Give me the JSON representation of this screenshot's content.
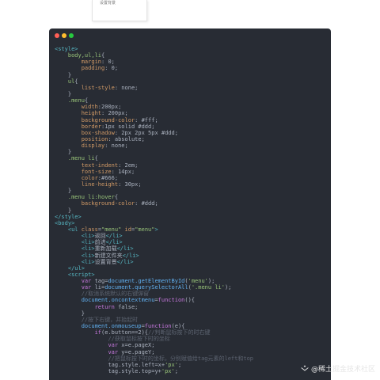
{
  "menu_preview": {
    "item": "设置背景"
  },
  "window": {
    "controls": [
      "close",
      "minimize",
      "maximize"
    ]
  },
  "code_lines": [
    [
      [
        "tag",
        "<style>"
      ]
    ],
    [
      [
        "txt",
        "    "
      ],
      [
        "sel",
        "body,ul,li"
      ],
      [
        "punc",
        "{"
      ]
    ],
    [
      [
        "txt",
        "        "
      ],
      [
        "prop",
        "margin"
      ],
      [
        "punc",
        ": 0;"
      ]
    ],
    [
      [
        "txt",
        "        "
      ],
      [
        "prop",
        "padding"
      ],
      [
        "punc",
        ": 0;"
      ]
    ],
    [
      [
        "txt",
        "    "
      ],
      [
        "punc",
        "}"
      ]
    ],
    [
      [
        "txt",
        "    "
      ],
      [
        "sel",
        "ul"
      ],
      [
        "punc",
        "{"
      ]
    ],
    [
      [
        "txt",
        "        "
      ],
      [
        "prop",
        "list-style"
      ],
      [
        "punc",
        ": none;"
      ]
    ],
    [
      [
        "txt",
        "    "
      ],
      [
        "punc",
        "}"
      ]
    ],
    [
      [
        "txt",
        "    "
      ],
      [
        "sel",
        ".menu"
      ],
      [
        "punc",
        "{"
      ]
    ],
    [
      [
        "txt",
        "        "
      ],
      [
        "prop",
        "width"
      ],
      [
        "punc",
        ":200px;"
      ]
    ],
    [
      [
        "txt",
        "        "
      ],
      [
        "prop",
        "height"
      ],
      [
        "punc",
        ": 200px;"
      ]
    ],
    [
      [
        "txt",
        "        "
      ],
      [
        "prop",
        "background-color"
      ],
      [
        "punc",
        ": #fff;"
      ]
    ],
    [
      [
        "txt",
        "        "
      ],
      [
        "prop",
        "border"
      ],
      [
        "punc",
        ":1px solid #ddd;"
      ]
    ],
    [
      [
        "txt",
        "        "
      ],
      [
        "prop",
        "box-shadow"
      ],
      [
        "punc",
        ": 2px 2px 5px #ddd;"
      ]
    ],
    [
      [
        "txt",
        "        "
      ],
      [
        "prop",
        "position"
      ],
      [
        "punc",
        ": absolute;"
      ]
    ],
    [
      [
        "txt",
        "        "
      ],
      [
        "prop",
        "display"
      ],
      [
        "punc",
        ": none;"
      ]
    ],
    [
      [
        "txt",
        "    "
      ],
      [
        "punc",
        "}"
      ]
    ],
    [
      [
        "txt",
        "    "
      ],
      [
        "sel",
        ".menu li"
      ],
      [
        "punc",
        "{"
      ]
    ],
    [
      [
        "txt",
        "        "
      ],
      [
        "prop",
        "text-indent"
      ],
      [
        "punc",
        ": 2em;"
      ]
    ],
    [
      [
        "txt",
        "        "
      ],
      [
        "prop",
        "font-size"
      ],
      [
        "punc",
        ": 14px;"
      ]
    ],
    [
      [
        "txt",
        "        "
      ],
      [
        "prop",
        "color"
      ],
      [
        "punc",
        ":#666;"
      ]
    ],
    [
      [
        "txt",
        "        "
      ],
      [
        "prop",
        "line-height"
      ],
      [
        "punc",
        ": 30px;"
      ]
    ],
    [
      [
        "txt",
        "    "
      ],
      [
        "punc",
        "}"
      ]
    ],
    [
      [
        "txt",
        "    "
      ],
      [
        "sel",
        ".menu li:hover"
      ],
      [
        "punc",
        "{"
      ]
    ],
    [
      [
        "txt",
        "        "
      ],
      [
        "prop",
        "background-color"
      ],
      [
        "punc",
        ": #ddd;"
      ]
    ],
    [
      [
        "txt",
        "    "
      ],
      [
        "punc",
        "}"
      ]
    ],
    [
      [
        "tag",
        "</style>"
      ]
    ],
    [
      [
        "tag",
        "<body>"
      ]
    ],
    [
      [
        "txt",
        "    "
      ],
      [
        "tag",
        "<ul"
      ],
      [
        "prop",
        " class"
      ],
      [
        "punc",
        "="
      ],
      [
        "str",
        "\"menu\""
      ],
      [
        "prop",
        " id"
      ],
      [
        "punc",
        "="
      ],
      [
        "str",
        "\"menu\""
      ],
      [
        "tag",
        ">"
      ]
    ],
    [
      [
        "txt",
        "        "
      ],
      [
        "tag",
        "<li>"
      ],
      [
        "txt",
        "返回"
      ],
      [
        "tag",
        "</li>"
      ]
    ],
    [
      [
        "txt",
        "        "
      ],
      [
        "tag",
        "<li>"
      ],
      [
        "txt",
        "前进"
      ],
      [
        "tag",
        "</li>"
      ]
    ],
    [
      [
        "txt",
        "        "
      ],
      [
        "tag",
        "<li>"
      ],
      [
        "txt",
        "重新加载"
      ],
      [
        "tag",
        "</li>"
      ]
    ],
    [
      [
        "txt",
        "        "
      ],
      [
        "tag",
        "<li>"
      ],
      [
        "txt",
        "新建文件夹"
      ],
      [
        "tag",
        "</li>"
      ]
    ],
    [
      [
        "txt",
        "        "
      ],
      [
        "tag",
        "<li>"
      ],
      [
        "txt",
        "设置背景"
      ],
      [
        "tag",
        "</li>"
      ]
    ],
    [
      [
        "txt",
        "    "
      ],
      [
        "tag",
        "</ul>"
      ]
    ],
    [
      [
        "txt",
        "    "
      ],
      [
        "tag",
        "<script>"
      ]
    ],
    [
      [
        "txt",
        "        "
      ],
      [
        "kw",
        "var"
      ],
      [
        "txt",
        " tag="
      ],
      [
        "fn",
        "document.getElementById"
      ],
      [
        "punc",
        "("
      ],
      [
        "str",
        "'menu'"
      ],
      [
        "punc",
        ");"
      ]
    ],
    [
      [
        "txt",
        "        "
      ],
      [
        "kw",
        "var"
      ],
      [
        "txt",
        " li="
      ],
      [
        "fn",
        "document.querySelectorAll"
      ],
      [
        "punc",
        "("
      ],
      [
        "str",
        "'.menu li'"
      ],
      [
        "punc",
        ");"
      ]
    ],
    [
      [
        "txt",
        "        "
      ],
      [
        "cmt",
        "//取消系统默认的右键弹窗"
      ]
    ],
    [
      [
        "txt",
        "        "
      ],
      [
        "fn",
        "document.oncontextmenu"
      ],
      [
        "punc",
        "="
      ],
      [
        "kw",
        "function"
      ],
      [
        "punc",
        "(){"
      ]
    ],
    [
      [
        "txt",
        "            "
      ],
      [
        "kw",
        "return"
      ],
      [
        "txt",
        " false;"
      ]
    ],
    [
      [
        "txt",
        "        "
      ],
      [
        "punc",
        "}"
      ]
    ],
    [
      [
        "txt",
        "        "
      ],
      [
        "cmt",
        "//按下右键，并抬起时"
      ]
    ],
    [
      [
        "txt",
        "        "
      ],
      [
        "fn",
        "document.onmouseup"
      ],
      [
        "punc",
        "="
      ],
      [
        "kw",
        "function"
      ],
      [
        "punc",
        "(e){"
      ]
    ],
    [
      [
        "txt",
        "            "
      ],
      [
        "kw",
        "if"
      ],
      [
        "punc",
        "("
      ],
      [
        "txt",
        "e.button==2"
      ],
      [
        "punc",
        "){"
      ],
      [
        "cmt",
        "//判断鼠标按下的时右键"
      ]
    ],
    [
      [
        "txt",
        "                "
      ],
      [
        "cmt",
        "//获取鼠标按下时的坐标"
      ]
    ],
    [
      [
        "txt",
        "                "
      ],
      [
        "kw",
        "var"
      ],
      [
        "txt",
        " x=e.pageX;"
      ]
    ],
    [
      [
        "txt",
        "                "
      ],
      [
        "kw",
        "var"
      ],
      [
        "txt",
        " y=e.pageY;"
      ]
    ],
    [
      [
        "txt",
        "                "
      ],
      [
        "cmt",
        "//把鼠标按下时的坐标，分别赋值给tag元素的left和top"
      ]
    ],
    [
      [
        "txt",
        "                "
      ],
      [
        "txt",
        "tag.style.left=x+"
      ],
      [
        "str",
        "'px'"
      ],
      [
        "punc",
        ";"
      ]
    ],
    [
      [
        "txt",
        "                "
      ],
      [
        "txt",
        "tag.style.top=y+"
      ],
      [
        "str",
        "'px'"
      ],
      [
        "punc",
        ";"
      ]
    ]
  ],
  "watermark": {
    "text": "@稀土掘金技术社区"
  }
}
